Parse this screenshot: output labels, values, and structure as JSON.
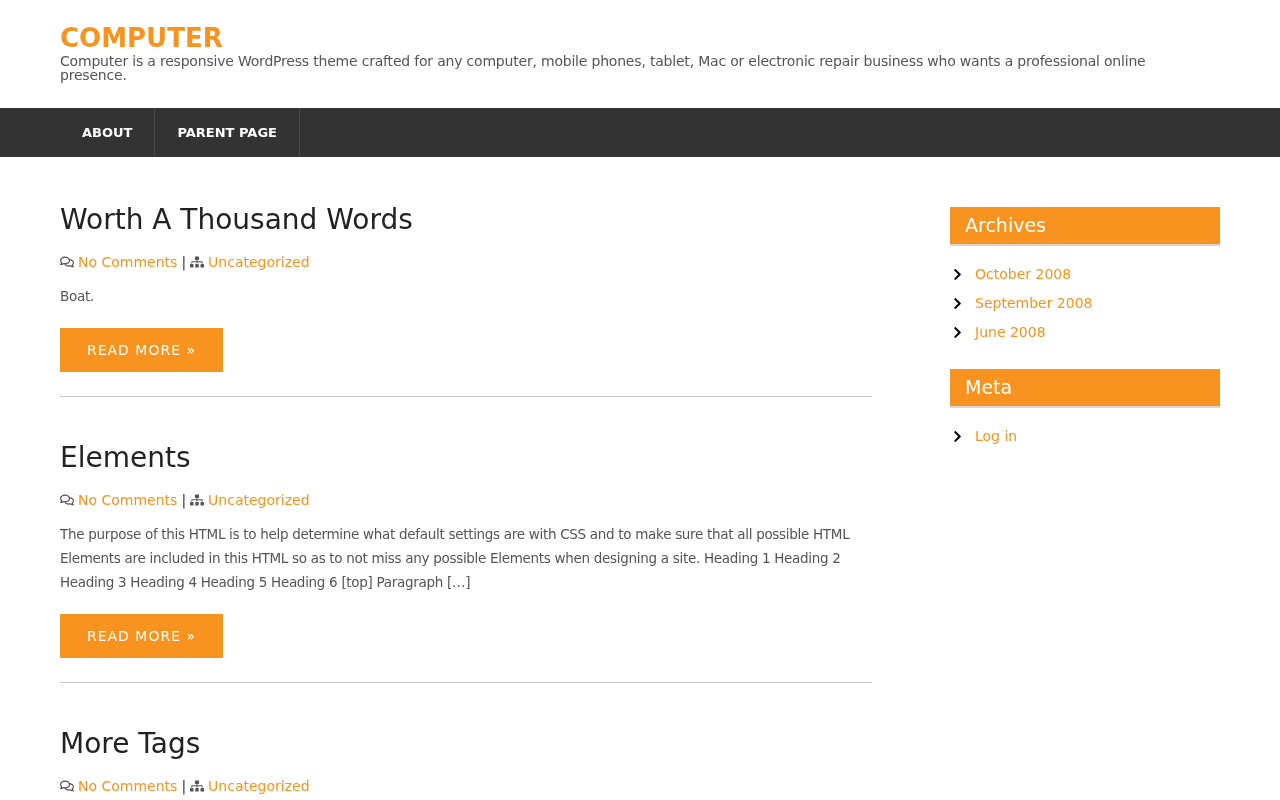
{
  "site": {
    "title": "COMPUTER",
    "tagline": "Computer is a responsive WordPress theme crafted for any computer, mobile phones, tablet, Mac or electronic repair business who wants a professional online presence."
  },
  "nav": [
    {
      "label": "ABOUT"
    },
    {
      "label": "PARENT PAGE"
    }
  ],
  "posts": [
    {
      "title": "Worth A Thousand Words",
      "comments": "No Comments",
      "separator": "|",
      "category": "Uncategorized",
      "excerpt": "Boat.",
      "button": "READ MORE »"
    },
    {
      "title": "Elements",
      "comments": "No Comments",
      "separator": "|",
      "category": "Uncategorized",
      "excerpt": "The purpose of this HTML is to help determine what default settings are with CSS and to make sure that all possible HTML Elements are included in this HTML so as to not miss any possible Elements when designing a site. Heading 1 Heading 2 Heading 3 Heading 4 Heading 5 Heading 6 [top] Paragraph […]",
      "button": "READ MORE »"
    },
    {
      "title": "More Tags",
      "comments": "No Comments",
      "separator": "|",
      "category": "Uncategorized"
    }
  ],
  "sidebar": {
    "widgets": [
      {
        "title": "Archives",
        "items": [
          "October 2008",
          "September 2008",
          "June 2008"
        ]
      },
      {
        "title": "Meta",
        "items": [
          "Log in"
        ]
      }
    ]
  }
}
